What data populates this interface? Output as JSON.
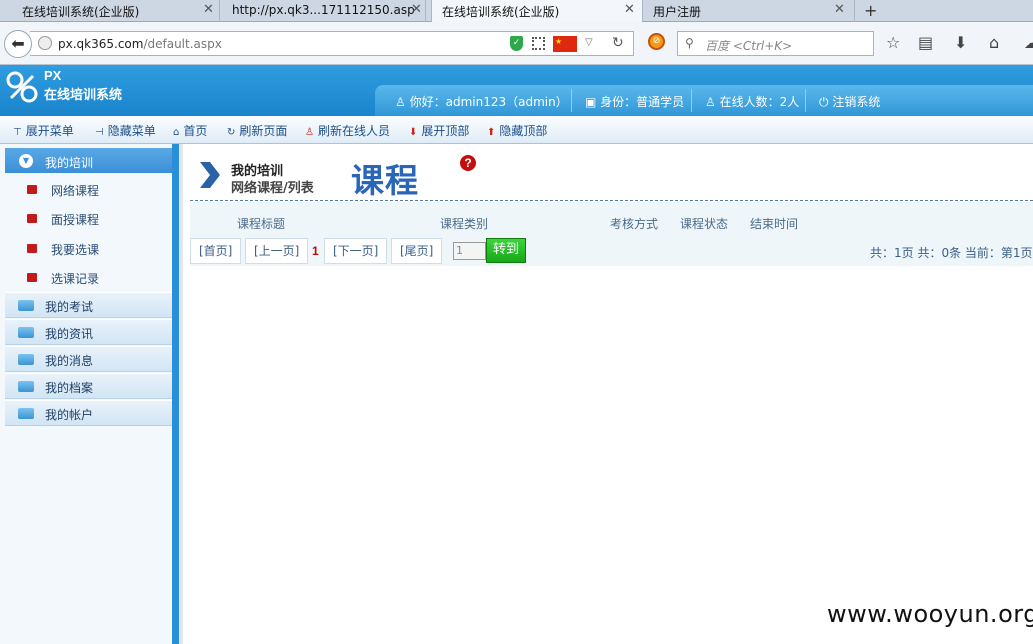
{
  "browser": {
    "tabs": [
      {
        "title": "在线培训系统(企业版)"
      },
      {
        "title": "http://px.qk3...171112150.asp"
      },
      {
        "title": "在线培训系统(企业版)"
      },
      {
        "title": "用户注册"
      }
    ],
    "new_tab": "+",
    "url_host": "px.qk365.com",
    "url_path": "/default.aspx",
    "search_placeholder": "百度 <Ctrl+K>"
  },
  "app": {
    "logo_short": "PX",
    "logo_name": "在线培训系统",
    "greeting": "你好：admin123（admin）",
    "identity": "身份：普通学员",
    "online": "在线人数：2人",
    "logout": "注销系统"
  },
  "toolbar": {
    "expand_menu": "展开菜单",
    "hide_menu": "隐藏菜单",
    "home": "首页",
    "refresh_page": "刷新页面",
    "refresh_online": "刷新在线人员",
    "expand_top": "展开顶部",
    "hide_top": "隐藏顶部"
  },
  "sidebar": {
    "active": "我的培训",
    "subitems": [
      "网络课程",
      "面授课程",
      "我要选课",
      "选课记录"
    ],
    "sections": [
      "我的考试",
      "我的资讯",
      "我的消息",
      "我的档案",
      "我的帐户"
    ]
  },
  "main": {
    "title_line1": "我的培训",
    "title_line2": "网络课程/列表",
    "big_title": "课程",
    "help": "?",
    "columns": [
      "课程标题",
      "课程类别",
      "考核方式",
      "课程状态",
      "结束时间"
    ],
    "pager": {
      "first": "[首页]",
      "prev": "[上一页]",
      "current": "1",
      "next": "[下一页]",
      "last": "[尾页]",
      "page_input": "1",
      "go": "转到",
      "info": "共：1页 共：0条 当前：第1页"
    }
  },
  "watermark": "www.wooyun.org"
}
